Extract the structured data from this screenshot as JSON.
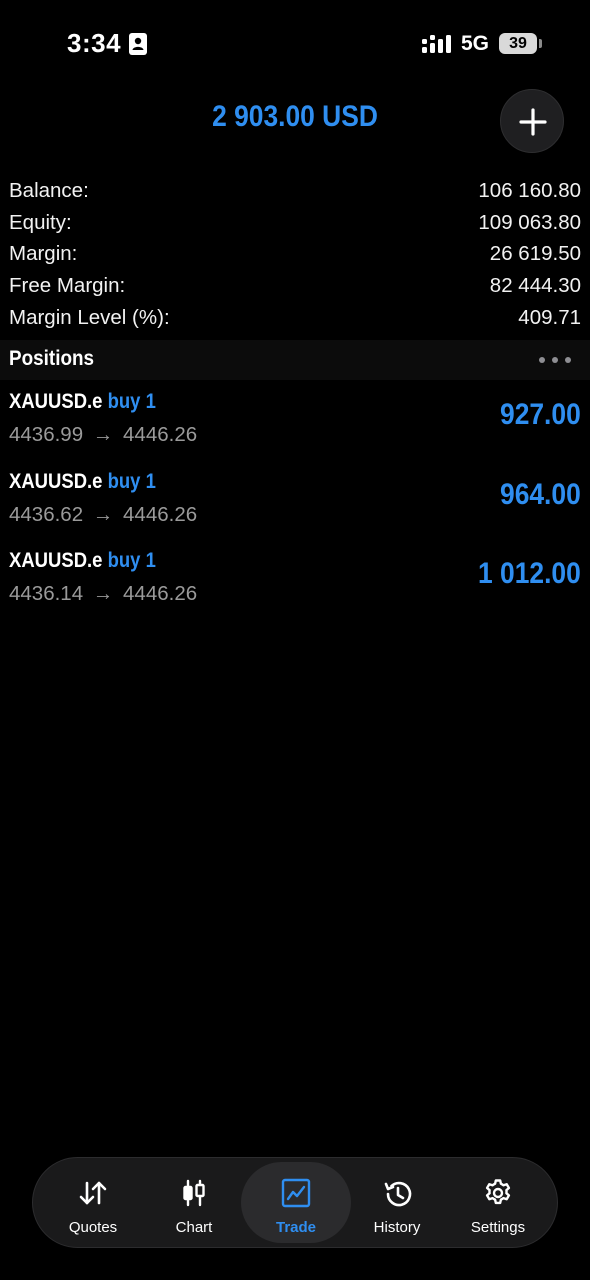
{
  "status_bar": {
    "time": "3:34",
    "network": "5G",
    "battery": "39"
  },
  "header": {
    "total_profit": "2 903.00 USD"
  },
  "account": {
    "rows": [
      {
        "label": "Balance:",
        "value": "106 160.80"
      },
      {
        "label": "Equity:",
        "value": "109 063.80"
      },
      {
        "label": "Margin:",
        "value": "26 619.50"
      },
      {
        "label": "Free Margin:",
        "value": "82 444.30"
      },
      {
        "label": "Margin Level (%):",
        "value": "409.71"
      }
    ]
  },
  "positions": {
    "title": "Positions",
    "items": [
      {
        "symbol": "XAUUSD.e",
        "side": "buy 1",
        "open_price": "4436.99",
        "arrow": "→",
        "current_price": "4446.26",
        "profit": "927.00"
      },
      {
        "symbol": "XAUUSD.e",
        "side": "buy 1",
        "open_price": "4436.62",
        "arrow": "→",
        "current_price": "4446.26",
        "profit": "964.00"
      },
      {
        "symbol": "XAUUSD.e",
        "side": "buy 1",
        "open_price": "4436.14",
        "arrow": "→",
        "current_price": "4446.26",
        "profit": "1 012.00"
      }
    ]
  },
  "tab_bar": {
    "tabs": [
      {
        "label": "Quotes",
        "icon": "quotes-icon",
        "active": false
      },
      {
        "label": "Chart",
        "icon": "candlestick-icon",
        "active": false
      },
      {
        "label": "Trade",
        "icon": "trade-chart-icon",
        "active": true
      },
      {
        "label": "History",
        "icon": "history-icon",
        "active": false
      },
      {
        "label": "Settings",
        "icon": "gear-icon",
        "active": false
      }
    ]
  },
  "colors": {
    "accent": "#2f8ef0",
    "background": "#000000",
    "secondary_text": "#9a9a9a"
  }
}
